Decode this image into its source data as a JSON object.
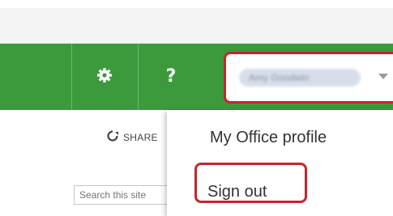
{
  "suite_bar": {
    "settings_icon": "gear-icon",
    "help_label": "?",
    "account_name": "Amy Goodwin"
  },
  "toolbar": {
    "share_label": "SHARE"
  },
  "search": {
    "placeholder": "Search this site"
  },
  "account_menu": {
    "items": [
      {
        "label": "My Office profile"
      },
      {
        "label": "Sign out"
      }
    ]
  },
  "colors": {
    "suite_bar": "#3c9a3c",
    "highlight": "#c3262c"
  }
}
